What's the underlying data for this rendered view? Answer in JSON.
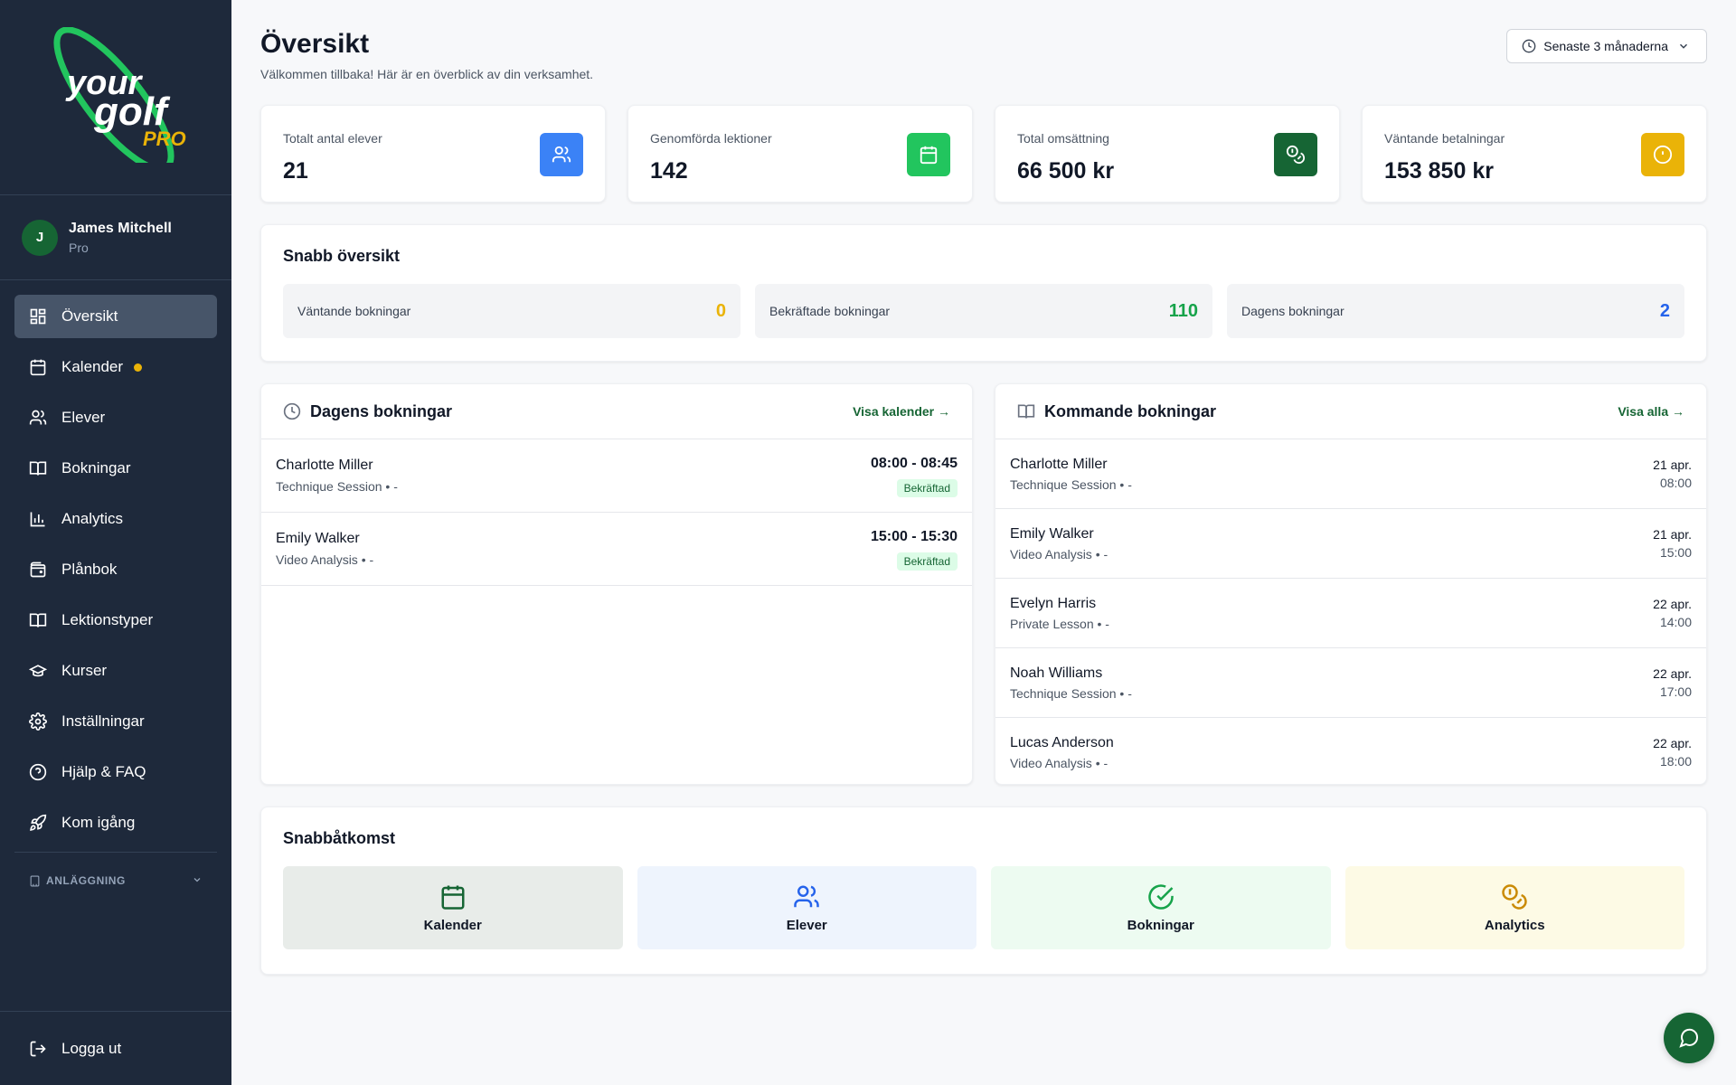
{
  "sidebar": {
    "logo": {
      "word1": "your",
      "word2": "golf",
      "word3": "PRO"
    },
    "user": {
      "initial": "J",
      "name": "James Mitchell",
      "role": "Pro"
    },
    "nav": [
      {
        "label": "Översikt",
        "icon": "dashboard-icon",
        "active": true
      },
      {
        "label": "Kalender",
        "icon": "calendar-icon",
        "dot": true
      },
      {
        "label": "Elever",
        "icon": "users-icon"
      },
      {
        "label": "Bokningar",
        "icon": "book-icon"
      },
      {
        "label": "Analytics",
        "icon": "bar-chart-icon"
      },
      {
        "label": "Plånbok",
        "icon": "wallet-icon"
      },
      {
        "label": "Lektionstyper",
        "icon": "book-open-icon"
      },
      {
        "label": "Kurser",
        "icon": "graduation-cap-icon"
      },
      {
        "label": "Inställningar",
        "icon": "gear-icon"
      },
      {
        "label": "Hjälp & FAQ",
        "icon": "help-circle-icon"
      },
      {
        "label": "Kom igång",
        "icon": "rocket-icon"
      }
    ],
    "section_label": "ANLÄGGNING",
    "logout_label": "Logga ut"
  },
  "header": {
    "title": "Översikt",
    "subtitle": "Välkommen tillbaka! Här är en överblick av din verksamhet.",
    "period_label": "Senaste 3 månaderna"
  },
  "stats": [
    {
      "label": "Totalt antal elever",
      "value": "21",
      "color": "#3b82f6",
      "icon": "users-icon"
    },
    {
      "label": "Genomförda lektioner",
      "value": "142",
      "color": "#22c55e",
      "icon": "calendar-icon"
    },
    {
      "label": "Total omsättning",
      "value": "66 500 kr",
      "color": "#166534",
      "icon": "coins-icon"
    },
    {
      "label": "Väntande betalningar",
      "value": "153 850 kr",
      "color": "#eab308",
      "icon": "alert-circle-icon"
    }
  ],
  "quick_overview": {
    "title": "Snabb översikt",
    "items": [
      {
        "label": "Väntande bokningar",
        "value": "0",
        "color": "#eab308"
      },
      {
        "label": "Bekräftade bokningar",
        "value": "110",
        "color": "#16a34a"
      },
      {
        "label": "Dagens bokningar",
        "value": "2",
        "color": "#2563eb"
      }
    ]
  },
  "today": {
    "title": "Dagens bokningar",
    "link": "Visa kalender →",
    "rows": [
      {
        "name": "Charlotte Miller",
        "type": "Technique Session • -",
        "time": "08:00 - 08:45",
        "status": "Bekräftad"
      },
      {
        "name": "Emily Walker",
        "type": "Video Analysis • -",
        "time": "15:00 - 15:30",
        "status": "Bekräftad"
      }
    ]
  },
  "upcoming": {
    "title": "Kommande bokningar",
    "link": "Visa alla →",
    "rows": [
      {
        "name": "Charlotte Miller",
        "type": "Technique Session • -",
        "date": "21 apr.",
        "time": "08:00"
      },
      {
        "name": "Emily Walker",
        "type": "Video Analysis • -",
        "date": "21 apr.",
        "time": "15:00"
      },
      {
        "name": "Evelyn Harris",
        "type": "Private Lesson • -",
        "date": "22 apr.",
        "time": "14:00"
      },
      {
        "name": "Noah Williams",
        "type": "Technique Session • -",
        "date": "22 apr.",
        "time": "17:00"
      },
      {
        "name": "Lucas Anderson",
        "type": "Video Analysis • -",
        "date": "22 apr.",
        "time": "18:00"
      }
    ]
  },
  "quick_access": {
    "title": "Snabbåtkomst",
    "items": [
      {
        "label": "Kalender",
        "icon": "calendar-icon",
        "bg": "#e8ece9",
        "color": "#166534"
      },
      {
        "label": "Elever",
        "icon": "users-icon",
        "bg": "#eef4fd",
        "color": "#2563eb"
      },
      {
        "label": "Bokningar",
        "icon": "check-circle-icon",
        "bg": "#edfbf1",
        "color": "#16a34a"
      },
      {
        "label": "Analytics",
        "icon": "coins-icon",
        "bg": "#fdfae5",
        "color": "#ca8a04"
      }
    ]
  }
}
